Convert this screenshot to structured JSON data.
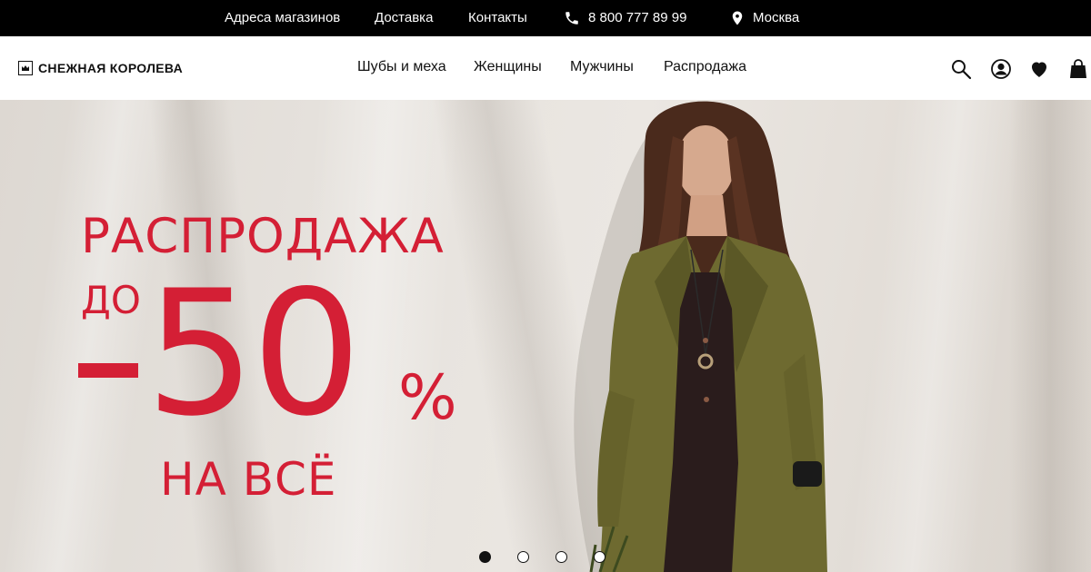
{
  "topbar": {
    "stores": "Адреса магазинов",
    "delivery": "Доставка",
    "contacts": "Контакты",
    "phone": "8 800 777 89 99",
    "city": "Москва",
    "phone_icon": "phone-icon",
    "location_icon": "location-pin-icon"
  },
  "header": {
    "logo_text": "СНЕЖНАЯ КОРОЛЕВА",
    "nav": [
      "Шубы и меха",
      "Женщины",
      "Мужчины",
      "Распродажа"
    ],
    "icons": [
      "search-icon",
      "account-icon",
      "favorites-heart-icon",
      "cart-bag-icon"
    ]
  },
  "hero": {
    "title": "РАСПРОДАЖА",
    "prefix": "ДО",
    "discount": "50",
    "percent": "%",
    "suffix": "НА ВСЁ",
    "accent_color": "#d41f35",
    "slides": 4,
    "active_slide": 1
  }
}
